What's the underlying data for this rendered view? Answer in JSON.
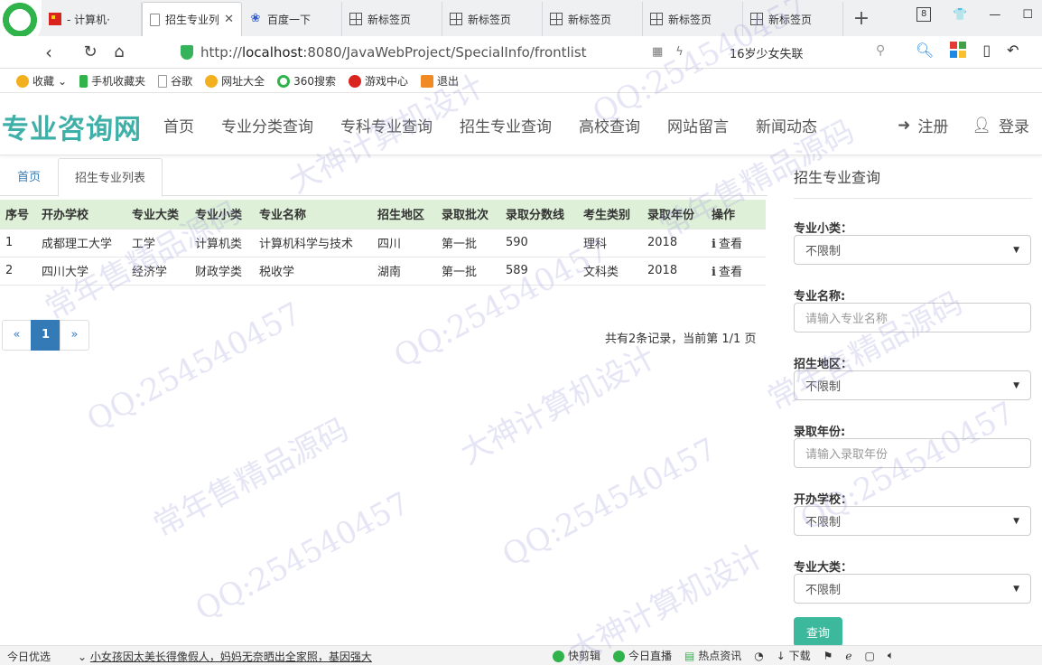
{
  "browser": {
    "tabs": [
      {
        "label": "- 计算机·",
        "icon": "flag-icon",
        "active": false,
        "closable": false
      },
      {
        "label": "招生专业列",
        "icon": "page-icon",
        "active": true,
        "closable": true
      },
      {
        "label": "百度一下",
        "icon": "paw-icon",
        "active": false,
        "closable": false
      },
      {
        "label": "新标签页",
        "icon": "grid-icon",
        "active": false,
        "closable": false
      },
      {
        "label": "新标签页",
        "icon": "grid-icon",
        "active": false,
        "closable": false
      },
      {
        "label": "新标签页",
        "icon": "grid-icon",
        "active": false,
        "closable": false
      },
      {
        "label": "新标签页",
        "icon": "grid-icon",
        "active": false,
        "closable": false
      },
      {
        "label": "新标签页",
        "icon": "grid-icon",
        "active": false,
        "closable": false
      }
    ],
    "new_tab": "+",
    "window_badge": "8",
    "url_host": "localhost",
    "url_prefix": "http://",
    "url_rest": ":8080/JavaWebProject/SpecialInfo/frontlist",
    "news_search": "16岁少女失联",
    "bookmarks": [
      {
        "label": "收藏",
        "color": "#f2b01e"
      },
      {
        "label": "手机收藏夹",
        "color": "#2fb34a"
      },
      {
        "label": "谷歌",
        "color": "#9e9e9e"
      },
      {
        "label": "网址大全",
        "color": "#f2b01e"
      },
      {
        "label": "360搜索",
        "color": "#2fb34a"
      },
      {
        "label": "游戏中心",
        "color": "#d9251d"
      },
      {
        "label": "退出",
        "color": "#f08a24"
      }
    ]
  },
  "site": {
    "brand": "专业咨询网",
    "brand_color": "#3fb0a8",
    "menu": [
      "首页",
      "专业分类查询",
      "专科专业查询",
      "招生专业查询",
      "高校查询",
      "网站留言",
      "新闻动态"
    ],
    "register": "注册",
    "login": "登录"
  },
  "breadcrumb": {
    "home": "首页",
    "current": "招生专业列表"
  },
  "table": {
    "headers": [
      "序号",
      "开办学校",
      "专业大类",
      "专业小类",
      "专业名称",
      "招生地区",
      "录取批次",
      "录取分数线",
      "考生类别",
      "录取年份",
      "操作"
    ],
    "rows": [
      {
        "no": "1",
        "school": "成都理工大学",
        "major_class": "工学",
        "sub_class": "计算机类",
        "major_name": "计算机科学与技术",
        "region": "四川",
        "batch": "第一批",
        "score": "590",
        "category": "理科",
        "year": "2018",
        "action": "查看"
      },
      {
        "no": "2",
        "school": "四川大学",
        "major_class": "经济学",
        "sub_class": "财政学类",
        "major_name": "税收学",
        "region": "湖南",
        "batch": "第一批",
        "score": "589",
        "category": "文科类",
        "year": "2018",
        "action": "查看"
      }
    ]
  },
  "pager": {
    "prev": "«",
    "current": "1",
    "next": "»",
    "info": "共有2条记录，当前第 1/1 页"
  },
  "sidebar": {
    "title": "招生专业查询",
    "sub_class_label": "专业小类：",
    "sub_class_value": "不限制",
    "major_name_label": "专业名称:",
    "major_name_placeholder": "请输入专业名称",
    "region_label": "招生地区：",
    "region_value": "不限制",
    "year_label": "录取年份:",
    "year_placeholder": "请输入录取年份",
    "school_label": "开办学校：",
    "school_value": "不限制",
    "major_class_label": "专业大类：",
    "major_class_value": "不限制",
    "query_button": "查询",
    "button_color": "#3cb99c"
  },
  "statusbar": {
    "left": "今日优选",
    "headline": "小女孩因太美长得像假人，妈妈无奈晒出全家照，基因强大",
    "items": [
      "快剪辑",
      "今日直播",
      "热点资讯",
      "下载"
    ]
  },
  "watermarks": [
    "QQ:254540457",
    "常年售精品源码",
    "大神计算机设计"
  ]
}
